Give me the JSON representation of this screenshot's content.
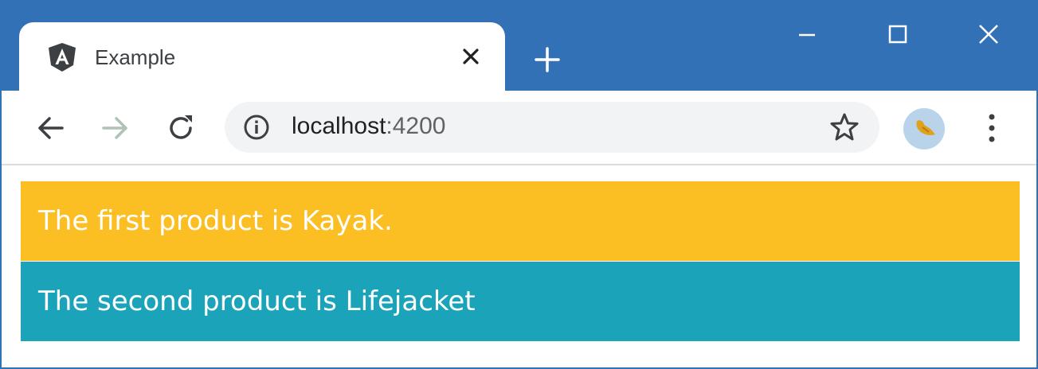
{
  "tab": {
    "title": "Example",
    "icon": "angular-logo-icon",
    "close_icon": "close-icon"
  },
  "window_controls": [
    "minimize-icon",
    "maximize-icon",
    "close-icon"
  ],
  "toolbar": {
    "back_icon": "arrow-left-icon",
    "forward_icon": "arrow-right-icon",
    "reload_icon": "reload-icon",
    "url_host": "localhost",
    "url_port": ":4200",
    "info_icon": "info-icon",
    "bookmark_icon": "star-icon",
    "menu_icon": "kebab-menu-icon"
  },
  "content": {
    "rows": [
      {
        "text": "The first product is Kayak.",
        "bg": "#fbbf24"
      },
      {
        "text": "The second product is Lifejacket",
        "bg": "#1aa3b9"
      }
    ]
  },
  "colors": {
    "titlebar": "#3271b6",
    "omnibox": "#f1f3f4",
    "text": "#3c4043"
  }
}
